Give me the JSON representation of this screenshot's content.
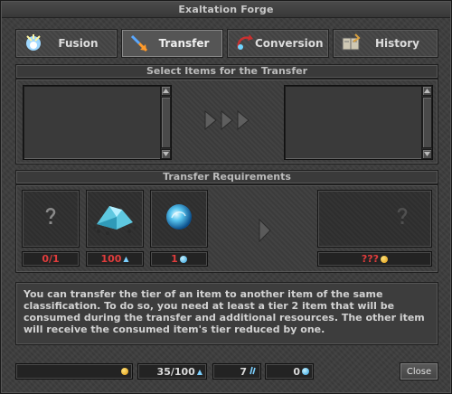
{
  "window": {
    "title": "Exaltation Forge"
  },
  "tabs": [
    {
      "label": "Fusion",
      "icon": "fusion-icon"
    },
    {
      "label": "Transfer",
      "icon": "transfer-icon",
      "active": true
    },
    {
      "label": "Conversion",
      "icon": "conversion-icon"
    },
    {
      "label": "History",
      "icon": "history-icon"
    }
  ],
  "select_panel": {
    "title": "Select Items for the Transfer"
  },
  "requirements_panel": {
    "title": "Transfer Requirements",
    "slots": [
      {
        "name": "unknown-item",
        "count": "0/1",
        "icon": "question-mark-icon"
      },
      {
        "name": "exalted-dust",
        "count": "100",
        "icon": "dust-icon",
        "currency_icon": "dust-small-icon"
      },
      {
        "name": "exalted-core",
        "count": "1",
        "icon": "core-icon",
        "currency_icon": "core-small-icon"
      }
    ],
    "result": {
      "cost": "???",
      "icon": "gold-coin-icon"
    }
  },
  "description": "You can transfer the tier of an item to another item of the same classification. To do so, you need at least a tier 2 item that will be consumed during the transfer and additional resources. The other item will receive the consumed item's tier reduced by one.",
  "bottom": {
    "gold": "",
    "dust": "35/100",
    "slivers": "7",
    "cores": "0",
    "close_label": "Close"
  },
  "colors": {
    "count_text": "#e03c3c",
    "gold": "#e09a10",
    "accent_blue": "#2aa0e0"
  }
}
